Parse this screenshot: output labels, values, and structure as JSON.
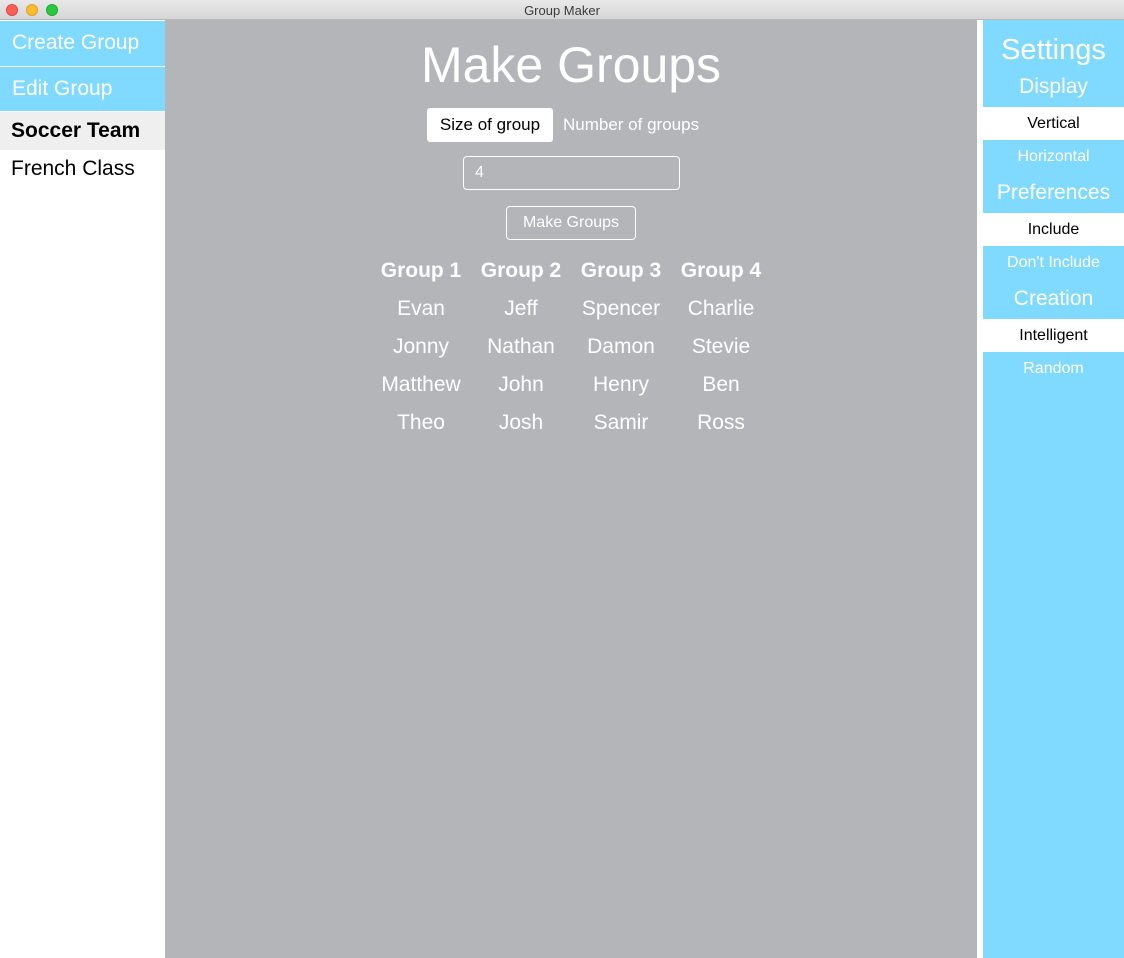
{
  "window": {
    "title": "Group Maker"
  },
  "sidebar": {
    "create_label": "Create Group",
    "edit_label": "Edit Group",
    "groups": [
      "Soccer Team",
      "French Class"
    ]
  },
  "main": {
    "title": "Make Groups",
    "mode_tabs": {
      "size": "Size of group",
      "number": "Number of groups",
      "selected": "Size of group"
    },
    "input_value": "4",
    "make_button": "Make Groups",
    "groups": [
      {
        "name": "Group 1",
        "members": [
          "Evan",
          "Jonny",
          "Matthew",
          "Theo"
        ]
      },
      {
        "name": "Group 2",
        "members": [
          "Jeff",
          "Nathan",
          "John",
          "Josh"
        ]
      },
      {
        "name": "Group 3",
        "members": [
          "Spencer",
          "Damon",
          "Henry",
          "Samir"
        ]
      },
      {
        "name": "Group 4",
        "members": [
          "Charlie",
          "Stevie",
          "Ben",
          "Ross"
        ]
      }
    ]
  },
  "settings": {
    "title": "Settings",
    "display": {
      "label": "Display",
      "options": [
        "Vertical",
        "Horizontal"
      ],
      "selected": "Vertical"
    },
    "preferences": {
      "label": "Preferences",
      "options": [
        "Include",
        "Don't Include"
      ],
      "selected": "Include"
    },
    "creation": {
      "label": "Creation",
      "options": [
        "Intelligent",
        "Random"
      ],
      "selected": "Intelligent"
    }
  },
  "colors": {
    "accent": "#80d9ff",
    "main_bg": "#b4b5b9",
    "selected_bg": "#efefef"
  }
}
